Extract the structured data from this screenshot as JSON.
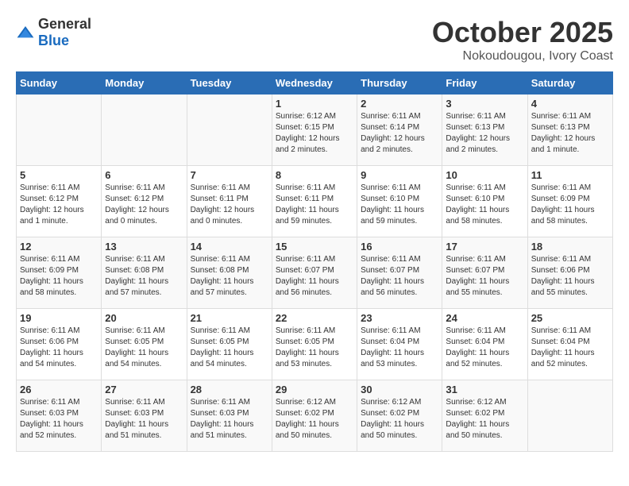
{
  "logo": {
    "general": "General",
    "blue": "Blue"
  },
  "header": {
    "month": "October 2025",
    "location": "Nokoudougou, Ivory Coast"
  },
  "weekdays": [
    "Sunday",
    "Monday",
    "Tuesday",
    "Wednesday",
    "Thursday",
    "Friday",
    "Saturday"
  ],
  "weeks": [
    [
      {
        "day": "",
        "info": ""
      },
      {
        "day": "",
        "info": ""
      },
      {
        "day": "",
        "info": ""
      },
      {
        "day": "1",
        "info": "Sunrise: 6:12 AM\nSunset: 6:15 PM\nDaylight: 12 hours\nand 2 minutes."
      },
      {
        "day": "2",
        "info": "Sunrise: 6:11 AM\nSunset: 6:14 PM\nDaylight: 12 hours\nand 2 minutes."
      },
      {
        "day": "3",
        "info": "Sunrise: 6:11 AM\nSunset: 6:13 PM\nDaylight: 12 hours\nand 2 minutes."
      },
      {
        "day": "4",
        "info": "Sunrise: 6:11 AM\nSunset: 6:13 PM\nDaylight: 12 hours\nand 1 minute."
      }
    ],
    [
      {
        "day": "5",
        "info": "Sunrise: 6:11 AM\nSunset: 6:12 PM\nDaylight: 12 hours\nand 1 minute."
      },
      {
        "day": "6",
        "info": "Sunrise: 6:11 AM\nSunset: 6:12 PM\nDaylight: 12 hours\nand 0 minutes."
      },
      {
        "day": "7",
        "info": "Sunrise: 6:11 AM\nSunset: 6:11 PM\nDaylight: 12 hours\nand 0 minutes."
      },
      {
        "day": "8",
        "info": "Sunrise: 6:11 AM\nSunset: 6:11 PM\nDaylight: 11 hours\nand 59 minutes."
      },
      {
        "day": "9",
        "info": "Sunrise: 6:11 AM\nSunset: 6:10 PM\nDaylight: 11 hours\nand 59 minutes."
      },
      {
        "day": "10",
        "info": "Sunrise: 6:11 AM\nSunset: 6:10 PM\nDaylight: 11 hours\nand 58 minutes."
      },
      {
        "day": "11",
        "info": "Sunrise: 6:11 AM\nSunset: 6:09 PM\nDaylight: 11 hours\nand 58 minutes."
      }
    ],
    [
      {
        "day": "12",
        "info": "Sunrise: 6:11 AM\nSunset: 6:09 PM\nDaylight: 11 hours\nand 58 minutes."
      },
      {
        "day": "13",
        "info": "Sunrise: 6:11 AM\nSunset: 6:08 PM\nDaylight: 11 hours\nand 57 minutes."
      },
      {
        "day": "14",
        "info": "Sunrise: 6:11 AM\nSunset: 6:08 PM\nDaylight: 11 hours\nand 57 minutes."
      },
      {
        "day": "15",
        "info": "Sunrise: 6:11 AM\nSunset: 6:07 PM\nDaylight: 11 hours\nand 56 minutes."
      },
      {
        "day": "16",
        "info": "Sunrise: 6:11 AM\nSunset: 6:07 PM\nDaylight: 11 hours\nand 56 minutes."
      },
      {
        "day": "17",
        "info": "Sunrise: 6:11 AM\nSunset: 6:07 PM\nDaylight: 11 hours\nand 55 minutes."
      },
      {
        "day": "18",
        "info": "Sunrise: 6:11 AM\nSunset: 6:06 PM\nDaylight: 11 hours\nand 55 minutes."
      }
    ],
    [
      {
        "day": "19",
        "info": "Sunrise: 6:11 AM\nSunset: 6:06 PM\nDaylight: 11 hours\nand 54 minutes."
      },
      {
        "day": "20",
        "info": "Sunrise: 6:11 AM\nSunset: 6:05 PM\nDaylight: 11 hours\nand 54 minutes."
      },
      {
        "day": "21",
        "info": "Sunrise: 6:11 AM\nSunset: 6:05 PM\nDaylight: 11 hours\nand 54 minutes."
      },
      {
        "day": "22",
        "info": "Sunrise: 6:11 AM\nSunset: 6:05 PM\nDaylight: 11 hours\nand 53 minutes."
      },
      {
        "day": "23",
        "info": "Sunrise: 6:11 AM\nSunset: 6:04 PM\nDaylight: 11 hours\nand 53 minutes."
      },
      {
        "day": "24",
        "info": "Sunrise: 6:11 AM\nSunset: 6:04 PM\nDaylight: 11 hours\nand 52 minutes."
      },
      {
        "day": "25",
        "info": "Sunrise: 6:11 AM\nSunset: 6:04 PM\nDaylight: 11 hours\nand 52 minutes."
      }
    ],
    [
      {
        "day": "26",
        "info": "Sunrise: 6:11 AM\nSunset: 6:03 PM\nDaylight: 11 hours\nand 52 minutes."
      },
      {
        "day": "27",
        "info": "Sunrise: 6:11 AM\nSunset: 6:03 PM\nDaylight: 11 hours\nand 51 minutes."
      },
      {
        "day": "28",
        "info": "Sunrise: 6:11 AM\nSunset: 6:03 PM\nDaylight: 11 hours\nand 51 minutes."
      },
      {
        "day": "29",
        "info": "Sunrise: 6:12 AM\nSunset: 6:02 PM\nDaylight: 11 hours\nand 50 minutes."
      },
      {
        "day": "30",
        "info": "Sunrise: 6:12 AM\nSunset: 6:02 PM\nDaylight: 11 hours\nand 50 minutes."
      },
      {
        "day": "31",
        "info": "Sunrise: 6:12 AM\nSunset: 6:02 PM\nDaylight: 11 hours\nand 50 minutes."
      },
      {
        "day": "",
        "info": ""
      }
    ]
  ]
}
